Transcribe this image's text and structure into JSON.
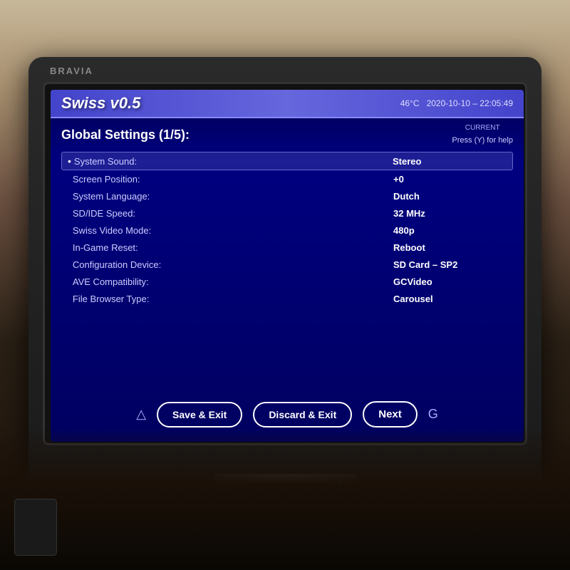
{
  "tv": {
    "brand": "BRAVIA"
  },
  "header": {
    "title": "Swiss v0.5",
    "temperature": "46°C",
    "datetime": "2020-10-10 – 22:05:49",
    "current_label": "CURRENT"
  },
  "settings": {
    "page_title": "Global Settings (1/5):",
    "help_text": "Press (Y) for help",
    "items": [
      {
        "label": "System Sound:",
        "value": "Stereo",
        "active": true
      },
      {
        "label": "Screen Position:",
        "value": "+0",
        "active": false
      },
      {
        "label": "System Language:",
        "value": "Dutch",
        "active": false
      },
      {
        "label": "SD/IDE Speed:",
        "value": "32 MHz",
        "active": false
      },
      {
        "label": "Swiss Video Mode:",
        "value": "480p",
        "active": false
      },
      {
        "label": "In-Game Reset:",
        "value": "Reboot",
        "active": false
      },
      {
        "label": "Configuration Device:",
        "value": "SD Card – SP2",
        "active": false
      },
      {
        "label": "AVE Compatibility:",
        "value": "GCVideo",
        "active": false
      },
      {
        "label": "File Browser Type:",
        "value": "Carousel",
        "active": false
      }
    ]
  },
  "buttons": {
    "save_exit": "Save & Exit",
    "discard_exit": "Discard & Exit",
    "next": "Next"
  }
}
